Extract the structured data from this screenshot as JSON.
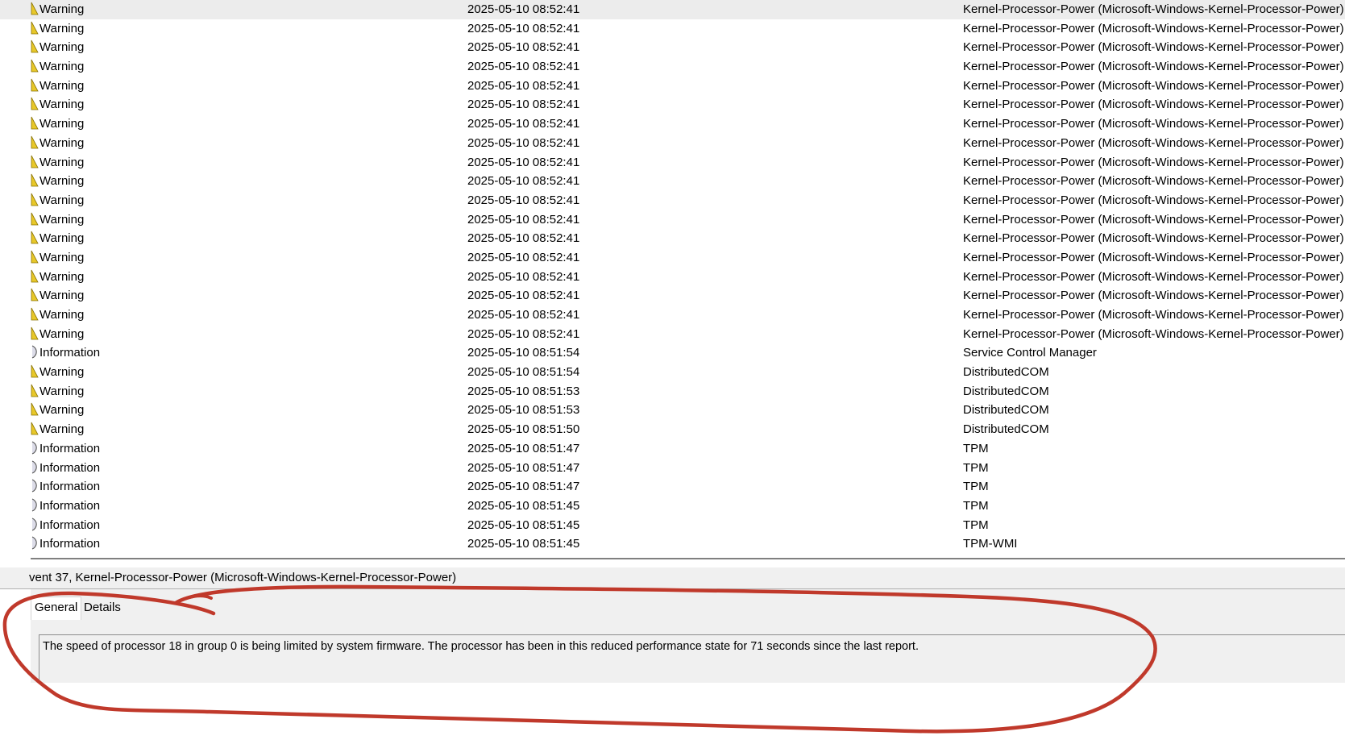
{
  "events": [
    {
      "level": "Warning",
      "icon": "warning-icon",
      "date": "2025-05-10 08:52:41",
      "source": "Kernel-Processor-Power (Microsoft-Windows-Kernel-Processor-Power)"
    },
    {
      "level": "Warning",
      "icon": "warning-icon",
      "date": "2025-05-10 08:52:41",
      "source": "Kernel-Processor-Power (Microsoft-Windows-Kernel-Processor-Power)"
    },
    {
      "level": "Warning",
      "icon": "warning-icon",
      "date": "2025-05-10 08:52:41",
      "source": "Kernel-Processor-Power (Microsoft-Windows-Kernel-Processor-Power)"
    },
    {
      "level": "Warning",
      "icon": "warning-icon",
      "date": "2025-05-10 08:52:41",
      "source": "Kernel-Processor-Power (Microsoft-Windows-Kernel-Processor-Power)"
    },
    {
      "level": "Warning",
      "icon": "warning-icon",
      "date": "2025-05-10 08:52:41",
      "source": "Kernel-Processor-Power (Microsoft-Windows-Kernel-Processor-Power)"
    },
    {
      "level": "Warning",
      "icon": "warning-icon",
      "date": "2025-05-10 08:52:41",
      "source": "Kernel-Processor-Power (Microsoft-Windows-Kernel-Processor-Power)"
    },
    {
      "level": "Warning",
      "icon": "warning-icon",
      "date": "2025-05-10 08:52:41",
      "source": "Kernel-Processor-Power (Microsoft-Windows-Kernel-Processor-Power)"
    },
    {
      "level": "Warning",
      "icon": "warning-icon",
      "date": "2025-05-10 08:52:41",
      "source": "Kernel-Processor-Power (Microsoft-Windows-Kernel-Processor-Power)"
    },
    {
      "level": "Warning",
      "icon": "warning-icon",
      "date": "2025-05-10 08:52:41",
      "source": "Kernel-Processor-Power (Microsoft-Windows-Kernel-Processor-Power)"
    },
    {
      "level": "Warning",
      "icon": "warning-icon",
      "date": "2025-05-10 08:52:41",
      "source": "Kernel-Processor-Power (Microsoft-Windows-Kernel-Processor-Power)"
    },
    {
      "level": "Warning",
      "icon": "warning-icon",
      "date": "2025-05-10 08:52:41",
      "source": "Kernel-Processor-Power (Microsoft-Windows-Kernel-Processor-Power)"
    },
    {
      "level": "Warning",
      "icon": "warning-icon",
      "date": "2025-05-10 08:52:41",
      "source": "Kernel-Processor-Power (Microsoft-Windows-Kernel-Processor-Power)"
    },
    {
      "level": "Warning",
      "icon": "warning-icon",
      "date": "2025-05-10 08:52:41",
      "source": "Kernel-Processor-Power (Microsoft-Windows-Kernel-Processor-Power)"
    },
    {
      "level": "Warning",
      "icon": "warning-icon",
      "date": "2025-05-10 08:52:41",
      "source": "Kernel-Processor-Power (Microsoft-Windows-Kernel-Processor-Power)"
    },
    {
      "level": "Warning",
      "icon": "warning-icon",
      "date": "2025-05-10 08:52:41",
      "source": "Kernel-Processor-Power (Microsoft-Windows-Kernel-Processor-Power)"
    },
    {
      "level": "Warning",
      "icon": "warning-icon",
      "date": "2025-05-10 08:52:41",
      "source": "Kernel-Processor-Power (Microsoft-Windows-Kernel-Processor-Power)"
    },
    {
      "level": "Warning",
      "icon": "warning-icon",
      "date": "2025-05-10 08:52:41",
      "source": "Kernel-Processor-Power (Microsoft-Windows-Kernel-Processor-Power)"
    },
    {
      "level": "Warning",
      "icon": "warning-icon",
      "date": "2025-05-10 08:52:41",
      "source": "Kernel-Processor-Power (Microsoft-Windows-Kernel-Processor-Power)"
    },
    {
      "level": "Information",
      "icon": "information-icon",
      "date": "2025-05-10 08:51:54",
      "source": "Service Control Manager"
    },
    {
      "level": "Warning",
      "icon": "warning-icon",
      "date": "2025-05-10 08:51:54",
      "source": "DistributedCOM"
    },
    {
      "level": "Warning",
      "icon": "warning-icon",
      "date": "2025-05-10 08:51:53",
      "source": "DistributedCOM"
    },
    {
      "level": "Warning",
      "icon": "warning-icon",
      "date": "2025-05-10 08:51:53",
      "source": "DistributedCOM"
    },
    {
      "level": "Warning",
      "icon": "warning-icon",
      "date": "2025-05-10 08:51:50",
      "source": "DistributedCOM"
    },
    {
      "level": "Information",
      "icon": "information-icon",
      "date": "2025-05-10 08:51:47",
      "source": "TPM"
    },
    {
      "level": "Information",
      "icon": "information-icon",
      "date": "2025-05-10 08:51:47",
      "source": "TPM"
    },
    {
      "level": "Information",
      "icon": "information-icon",
      "date": "2025-05-10 08:51:47",
      "source": "TPM"
    },
    {
      "level": "Information",
      "icon": "information-icon",
      "date": "2025-05-10 08:51:45",
      "source": "TPM"
    },
    {
      "level": "Information",
      "icon": "information-icon",
      "date": "2025-05-10 08:51:45",
      "source": "TPM"
    },
    {
      "level": "Information",
      "icon": "information-icon",
      "date": "2025-05-10 08:51:45",
      "source": "TPM-WMI"
    }
  ],
  "detail": {
    "header": "vent 37, Kernel-Processor-Power (Microsoft-Windows-Kernel-Processor-Power)",
    "tabs": {
      "general": "General",
      "details": "Details"
    },
    "message": "The speed of processor 18 in group 0 is being limited by system firmware. The processor has been in this reduced performance state for 71 seconds since the last report."
  },
  "colors": {
    "annotation": "#c0392b",
    "warning": "#e8c82a",
    "selected_row": "#ececec"
  }
}
